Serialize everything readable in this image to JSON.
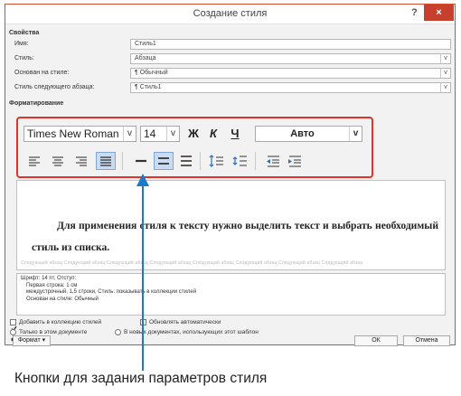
{
  "dialog": {
    "title": "Создание стиля",
    "help": "?",
    "close": "×",
    "properties_header": "Свойства",
    "name_label": "Имя:",
    "name_value": "Стиль1",
    "style_type_label": "Стиль:",
    "style_type_value": "Абзаца",
    "based_on_label": "Основан на стиле:",
    "based_on_value": "¶ Обычный",
    "next_style_label": "Стиль следующего абзаца:",
    "next_style_value": "¶ Стиль1",
    "formatting_header": "Форматирование"
  },
  "formatting": {
    "font": "Times New Roman",
    "size": "14",
    "bold": "Ж",
    "italic": "К",
    "underline": "Ч",
    "color": "Авто",
    "dropdown_glyph": "v"
  },
  "preview": {
    "text": "Для применения стиля к тексту нужно выделить текст и выбрать необходимый стиль из списка.",
    "ghost_text": "Следующий абзац Следующий абзац Следующий абзац Следующий абзац Следующий абзац Следующий абзац Следующий абзац Следующий абзац"
  },
  "description": {
    "line1": "Шрифт: 14 пт, Отступ:",
    "line2": "Первая строка: 1 см",
    "line3": "междустрочный, 1,5 строки, Стиль: показывать в коллекции стилей",
    "line4": "Основан на стиле: Обычный"
  },
  "options": {
    "add_to_gallery": "Добавить в коллекцию стилей",
    "auto_update": "Обновлять автоматически",
    "only_this_doc": "Только в этом документе",
    "new_docs": "В новых документах, использующих этот шаблон"
  },
  "buttons": {
    "format": "Формат ▾",
    "ok": "ОК",
    "cancel": "Отмена"
  },
  "caption": "Кнопки для задания параметров стиля",
  "colors": {
    "highlight_frame": "#e0342b",
    "pointer_arrow": "#1b79c8",
    "close_button": "#c7402e"
  }
}
